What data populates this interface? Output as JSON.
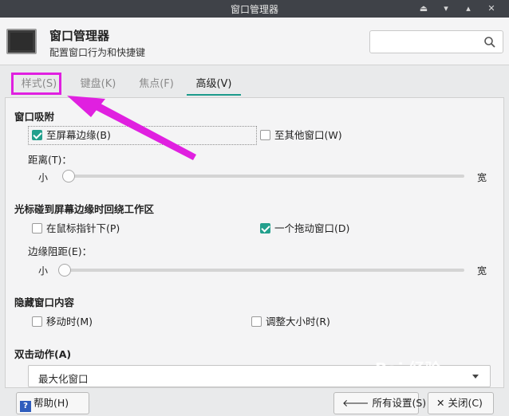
{
  "window": {
    "title": "窗口管理器"
  },
  "header": {
    "title": "窗口管理器",
    "subtitle": "配置窗口行为和快捷键",
    "search_placeholder": ""
  },
  "tabs": [
    {
      "label": "样式(S)"
    },
    {
      "label": "键盘(K)"
    },
    {
      "label": "焦点(F)"
    },
    {
      "label": "高级(V)"
    }
  ],
  "snap": {
    "heading": "窗口吸附",
    "to_screen_edge": {
      "label": "至屏幕边缘(B)",
      "checked": true
    },
    "to_other_windows": {
      "label": "至其他窗口(W)",
      "checked": false
    },
    "distance_label": "距离(T)：",
    "min_label": "小",
    "max_label": "宽",
    "distance_level": 0.0
  },
  "wrap": {
    "heading": "光标碰到屏幕边缘时回绕工作区",
    "under_pointer": {
      "label": "在鼠标指针下(P)",
      "checked": false
    },
    "drag_window": {
      "label": "一个拖动窗口(D)",
      "checked": true
    },
    "resistance_label": "边缘阻距(E)：",
    "min_label": "小",
    "max_label": "宽",
    "resistance_level": 0.0
  },
  "hide": {
    "heading": "隐藏窗口内容",
    "when_moving": {
      "label": "移动时(M)",
      "checked": false
    },
    "when_resizing": {
      "label": "调整大小时(R)",
      "checked": false
    }
  },
  "double_click": {
    "heading": "双击动作(A)",
    "selected": "最大化窗口"
  },
  "footer": {
    "help": "帮助(H)",
    "all_settings": "所有设置(S)",
    "close": "关闭(C)"
  },
  "annotation_color": "#e020e0",
  "watermark": {
    "text": "Bai 经验",
    "sub": "jingyan.baidu.com"
  }
}
